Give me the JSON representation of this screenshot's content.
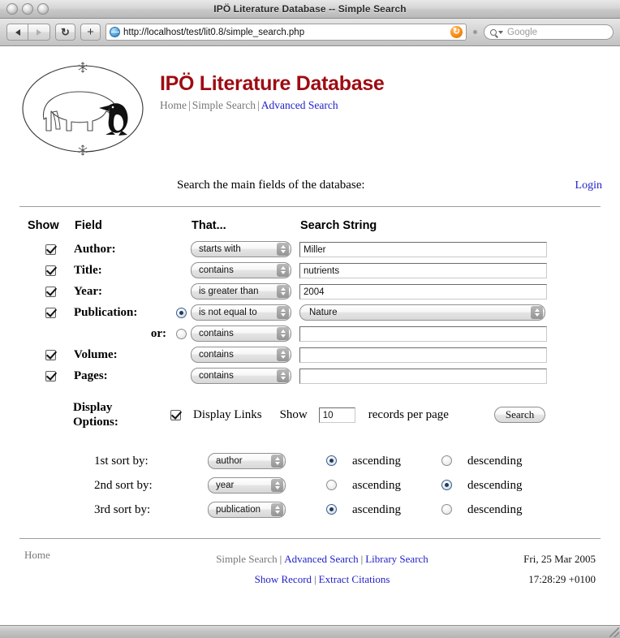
{
  "window": {
    "title": "IPÖ Literature Database -- Simple Search",
    "buttons": [
      "close-button",
      "minimize-button",
      "zoom-button"
    ]
  },
  "toolbar": {
    "back_icon": "back-arrow-icon",
    "forward_icon": "forward-arrow-icon",
    "reload_icon": "reload-icon",
    "reload_glyph": "↻",
    "add_glyph": "+",
    "url": "http://localhost/test/lit0.8/simple_search.php",
    "rss_glyph": "↻",
    "search_placeholder": "Google"
  },
  "header": {
    "logo_alt": "polar-bear-penguin-logo",
    "site_title": "IPÖ Literature Database",
    "nav": [
      {
        "label": "Home",
        "active": false
      },
      {
        "label": "Simple Search",
        "active": false
      },
      {
        "label": "Advanced Search",
        "active": true
      }
    ],
    "nav_separator": "|",
    "subtitle": "Search the main fields of the database:",
    "login_label": "Login"
  },
  "form": {
    "columns": [
      "Show",
      "Field",
      "That...",
      "Search String"
    ],
    "rows": [
      {
        "show_checked": true,
        "label": "Author:",
        "radio": null,
        "operator": "starts with",
        "value": "Miller",
        "input_type": "text"
      },
      {
        "show_checked": true,
        "label": "Title:",
        "radio": null,
        "operator": "contains",
        "value": "nutrients",
        "input_type": "text"
      },
      {
        "show_checked": true,
        "label": "Year:",
        "radio": null,
        "operator": "is greater than",
        "value": "2004",
        "input_type": "text"
      },
      {
        "show_checked": true,
        "label": "Publication:",
        "radio": true,
        "operator": "is not equal to",
        "value": "Nature",
        "input_type": "select"
      },
      {
        "show_checked": null,
        "label": "or:",
        "radio": false,
        "operator": "contains",
        "value": "",
        "input_type": "text"
      },
      {
        "show_checked": true,
        "label": "Volume:",
        "radio": null,
        "operator": "contains",
        "value": "",
        "input_type": "text"
      },
      {
        "show_checked": true,
        "label": "Pages:",
        "radio": null,
        "operator": "contains",
        "value": "",
        "input_type": "text"
      }
    ]
  },
  "display_options": {
    "label_line1": "Display",
    "label_line2": "Options:",
    "display_links_checked": true,
    "display_links_label": "Display Links",
    "show_label": "Show",
    "records_value": "10",
    "records_label": "records per page",
    "search_button": "Search"
  },
  "sorting": {
    "rows": [
      {
        "label": "1st sort by:",
        "field": "author",
        "ascending_label": "ascending",
        "descending_label": "descending",
        "direction": "ascending"
      },
      {
        "label": "2nd sort by:",
        "field": "year",
        "ascending_label": "ascending",
        "descending_label": "descending",
        "direction": "descending"
      },
      {
        "label": "3rd sort by:",
        "field": "publication",
        "ascending_label": "ascending",
        "descending_label": "descending",
        "direction": "ascending"
      }
    ]
  },
  "footer": {
    "home_label": "Home",
    "links_row1": [
      {
        "label": "Simple Search",
        "active": false
      },
      {
        "label": "Advanced Search",
        "active": true
      },
      {
        "label": "Library Search",
        "active": true
      }
    ],
    "links_row2": [
      {
        "label": "Show Record",
        "active": true
      },
      {
        "label": "Extract Citations",
        "active": true
      }
    ],
    "separator": "|",
    "date": "Fri, 25 Mar 2005",
    "time": "17:28:29 +0100"
  },
  "colors": {
    "brand_red": "#9e0b12",
    "link_blue": "#2121c8",
    "inactive_gray": "#777777"
  }
}
